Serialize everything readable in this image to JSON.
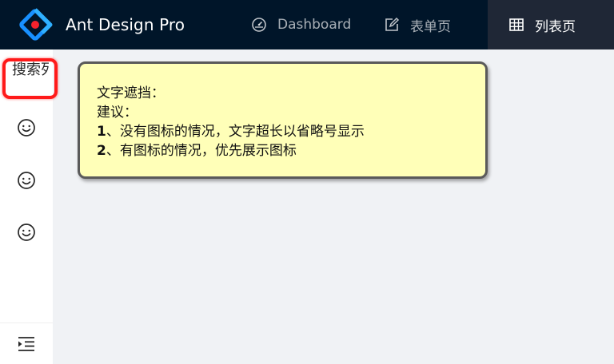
{
  "header": {
    "brand": "Ant Design Pro",
    "nav": [
      {
        "label": "Dashboard",
        "icon": "dashboard-icon"
      },
      {
        "label": "表单页",
        "icon": "form-icon"
      },
      {
        "label": "列表页",
        "icon": "table-icon",
        "active": true
      }
    ]
  },
  "sidebar": {
    "search_label": "搜索列表",
    "items": [
      {
        "icon": "smile-icon"
      },
      {
        "icon": "smile-icon"
      },
      {
        "icon": "smile-icon"
      }
    ],
    "collapse_icon": "menu-unfold-icon"
  },
  "note": {
    "title": "文字遮挡：",
    "advice": "建议：",
    "point1_num": "1",
    "point1_text": "、没有图标的情况，文字超长以省略号显示",
    "point2_num": "2",
    "point2_text": "、有图标的情况，优先展示图标"
  },
  "colors": {
    "header_bg": "#001529",
    "active_nav_bg": "#1f2736",
    "highlight_border": "#ff1a1a",
    "note_bg": "#ffffb8"
  }
}
